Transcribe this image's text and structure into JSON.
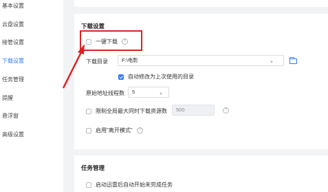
{
  "sidebar": {
    "items": [
      {
        "label": "基本设置"
      },
      {
        "label": "云盘设置"
      },
      {
        "label": "接管设置"
      },
      {
        "label": "下载设置"
      },
      {
        "label": "任务管理"
      },
      {
        "label": "提醒"
      },
      {
        "label": "悬浮窗"
      },
      {
        "label": "高级设置"
      }
    ],
    "active": "下载设置"
  },
  "download": {
    "title": "下载设置",
    "one_click_label": "一键下载",
    "dir_label": "下载目录",
    "dir_value": "F:\\电影",
    "auto_modify_label": "自动修改为上次使用的目录",
    "threads_label": "原始地址线程数",
    "threads_value": "5",
    "limit_label": "限制全局最大同时下载资源数",
    "limit_value": "500",
    "leave_mode_label": "启用\"离开模式\""
  },
  "tasks": {
    "title": "任务管理",
    "auto_start_label": "启动迅雷后自动开始未完成任务"
  },
  "icons": {
    "help": "help-circle-icon",
    "folder": "folder-icon",
    "dropdown": "chevron-down-icon"
  },
  "colors": {
    "accent": "#2f7cf6",
    "annotation": "#e02020"
  }
}
